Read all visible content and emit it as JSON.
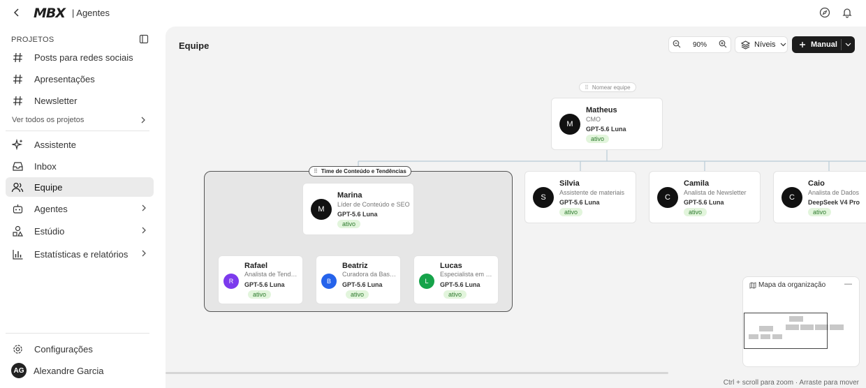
{
  "app": {
    "logo": "MBX",
    "name": "| Agentes"
  },
  "sidebar": {
    "section": "PROJETOS",
    "projects": [
      {
        "label": "Posts para redes sociais"
      },
      {
        "label": "Apresentações"
      },
      {
        "label": "Newsletter"
      }
    ],
    "see_all": "Ver todos os projetos",
    "nav": [
      {
        "label": "Assistente",
        "icon": "sparkle-icon"
      },
      {
        "label": "Inbox",
        "icon": "inbox-icon"
      },
      {
        "label": "Equipe",
        "icon": "team-icon"
      },
      {
        "label": "Agentes",
        "icon": "robot-icon"
      },
      {
        "label": "Estúdio",
        "icon": "shapes-icon"
      },
      {
        "label": "Estatísticas e relatórios",
        "icon": "bar-chart-icon"
      }
    ],
    "settings": "Configurações",
    "user": {
      "initials": "AG",
      "name": "Alexandre Garcia"
    }
  },
  "canvas": {
    "title": "Equipe",
    "zoom": "90%",
    "levels_label": "Níveis",
    "manual_label": "Manual",
    "name_team": "Nomear equipe",
    "team_label": "Time de Conteúdo e Tendências",
    "minimap_title": "Mapa da organização",
    "hint": "Ctrl + scroll para zoom  ·  Arraste para mover"
  },
  "org": {
    "root": {
      "initial": "M",
      "name": "Matheus",
      "role": "CMO",
      "model": "GPT-5.6 Luna",
      "status": "ativo",
      "color": "#111111"
    },
    "level2": [
      {
        "initial": "M",
        "name": "Marina",
        "role": "Líder de Conteúdo e SEO",
        "model": "GPT-5.6 Luna",
        "status": "ativo",
        "color": "#111111"
      },
      {
        "initial": "S",
        "name": "Silvia",
        "role": "Assistente de materiais",
        "model": "GPT-5.6 Luna",
        "status": "ativo",
        "color": "#111111"
      },
      {
        "initial": "C",
        "name": "Camila",
        "role": "Analista de Newsletter",
        "model": "GPT-5.6 Luna",
        "status": "ativo",
        "color": "#111111"
      },
      {
        "initial": "C",
        "name": "Caio",
        "role": "Analista de Dados",
        "model": "DeepSeek V4 Pro",
        "status": "ativo",
        "color": "#111111"
      }
    ],
    "level3": [
      {
        "initial": "R",
        "name": "Rafael",
        "role": "Analista de Tendências",
        "model": "GPT-5.6 Luna",
        "status": "ativo",
        "color": "#7c3aed"
      },
      {
        "initial": "B",
        "name": "Beatriz",
        "role": "Curadora da Base de Conhecimento",
        "model": "GPT-5.6 Luna",
        "status": "ativo",
        "color": "#2563eb"
      },
      {
        "initial": "L",
        "name": "Lucas",
        "role": "Especialista em Conteúdo",
        "model": "GPT-5.6 Luna",
        "status": "ativo",
        "color": "#16a34a"
      }
    ]
  }
}
